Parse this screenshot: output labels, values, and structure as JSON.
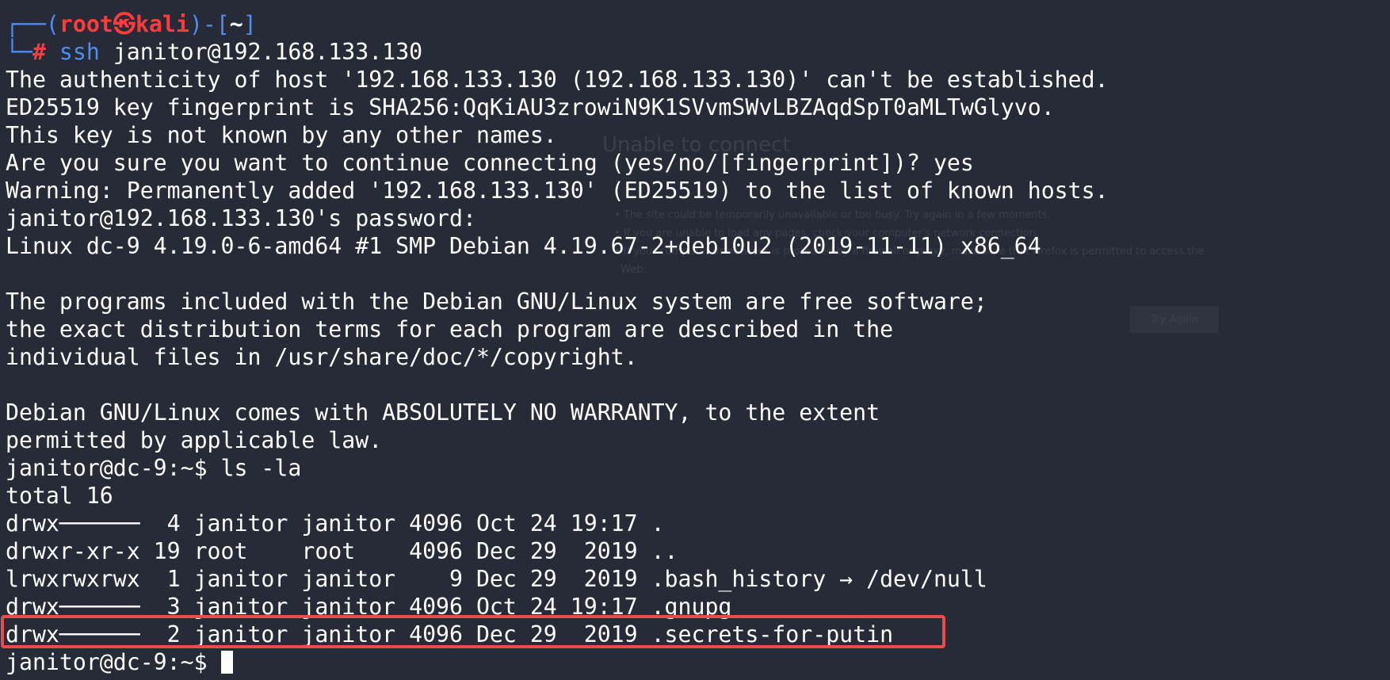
{
  "prompt": {
    "frame_top_left": "┌──(",
    "user": "root",
    "skull": "㉿",
    "host": "kali",
    "frame_mid": ")-[",
    "cwd": "~",
    "frame_end": "]",
    "frame_bottom": "└─",
    "hash": "#",
    "cmd_name": "ssh",
    "cmd_args": " janitor@192.168.133.130"
  },
  "output": [
    "The authenticity of host '192.168.133.130 (192.168.133.130)' can't be established.",
    "ED25519 key fingerprint is SHA256:QqKiAU3zrowiN9K1SVvmSWvLBZAqdSpT0aMLTwGlyvo.",
    "This key is not known by any other names.",
    "Are you sure you want to continue connecting (yes/no/[fingerprint])? yes",
    "Warning: Permanently added '192.168.133.130' (ED25519) to the list of known hosts.",
    "janitor@192.168.133.130's password: ",
    "Linux dc-9 4.19.0-6-amd64 #1 SMP Debian 4.19.67-2+deb10u2 (2019-11-11) x86_64",
    "",
    "The programs included with the Debian GNU/Linux system are free software;",
    "the exact distribution terms for each program are described in the",
    "individual files in /usr/share/doc/*/copyright.",
    "",
    "Debian GNU/Linux comes with ABSOLUTELY NO WARRANTY, to the extent",
    "permitted by applicable law.",
    "janitor@dc-9:~$ ls -la",
    "total 16",
    "drwx──────  4 janitor janitor 4096 Oct 24 19:17 .",
    "drwxr-xr-x 19 root    root    4096 Dec 29  2019 ..",
    "lrwxrwxrwx  1 janitor janitor    9 Dec 29  2019 .bash_history → /dev/null",
    "drwx──────  3 janitor janitor 4096 Oct 24 19:17 .gnupg",
    "drwx──────  2 janitor janitor 4096 Dec 29  2019 .secrets-for-putin"
  ],
  "final_prompt": "janitor@dc-9:~$ ",
  "colors": {
    "background": "#272b37",
    "prompt_blue": "#4f8cf0",
    "prompt_red": "#ff3b3b",
    "highlight_red": "#ec4b4b"
  }
}
